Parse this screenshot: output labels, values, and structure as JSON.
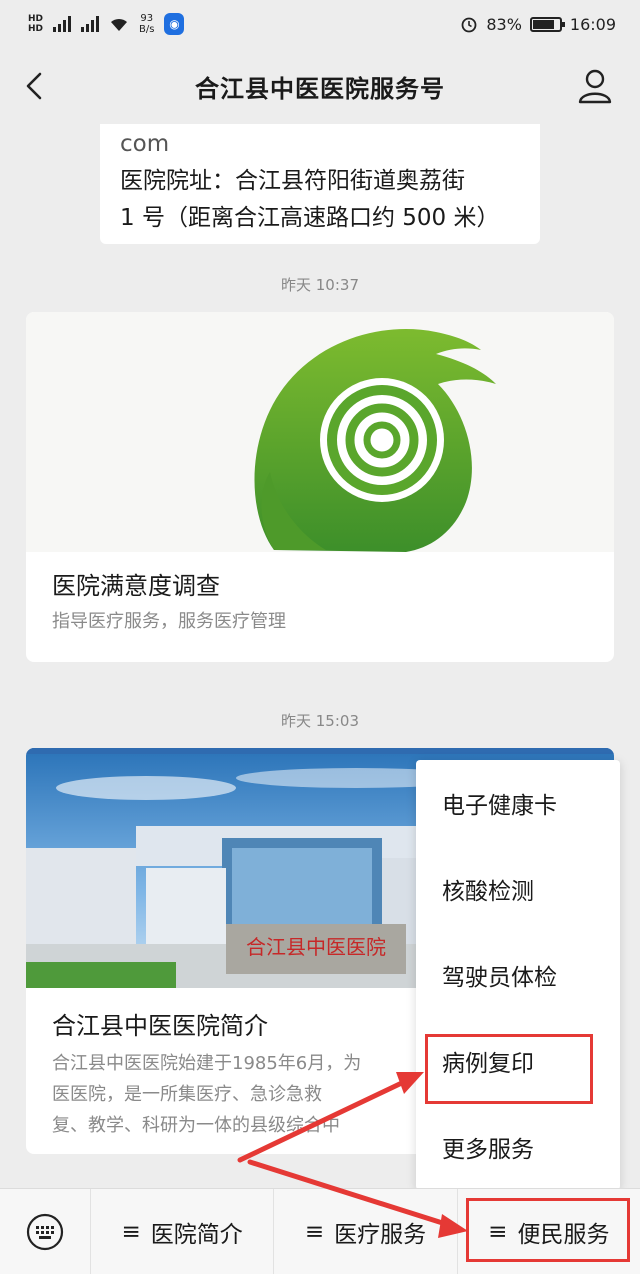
{
  "status_bar": {
    "net_tag1": "HD",
    "net_tag2": "HD",
    "speed_value": "93",
    "speed_unit": "B/s",
    "battery": "83%",
    "time": "16:09",
    "battery_level": 0.83
  },
  "nav": {
    "title": "合江县中医医院服务号"
  },
  "message": {
    "line1": "com",
    "line2": "医院院址：合江县符阳街道奥荔街",
    "line3": "1 号（距离合江高速路口约 500 米）"
  },
  "timestamps": [
    "昨天 10:37",
    "昨天 15:03"
  ],
  "card1": {
    "title": "医院满意度调查",
    "desc": "指导医疗服务，服务医疗管理"
  },
  "card2": {
    "title": "合江县中医医院简介",
    "desc1": "合江县中医医院始建于1985年6月，为",
    "desc2": "医医院，是一所集医疗、急诊急救",
    "desc3": "复、教学、科研为一体的县级综合中",
    "sign_text": "合江县中医医院"
  },
  "popup": {
    "items": [
      "电子健康卡",
      "核酸检测",
      "驾驶员体检",
      "病例复印",
      "更多服务"
    ]
  },
  "menu": {
    "menu_icon": "≡",
    "items": [
      "医院简介",
      "医疗服务",
      "便民服务"
    ]
  },
  "colors": {
    "background": "#ededed",
    "highlight": "#e53935",
    "logo_green": "#5aa62c"
  }
}
